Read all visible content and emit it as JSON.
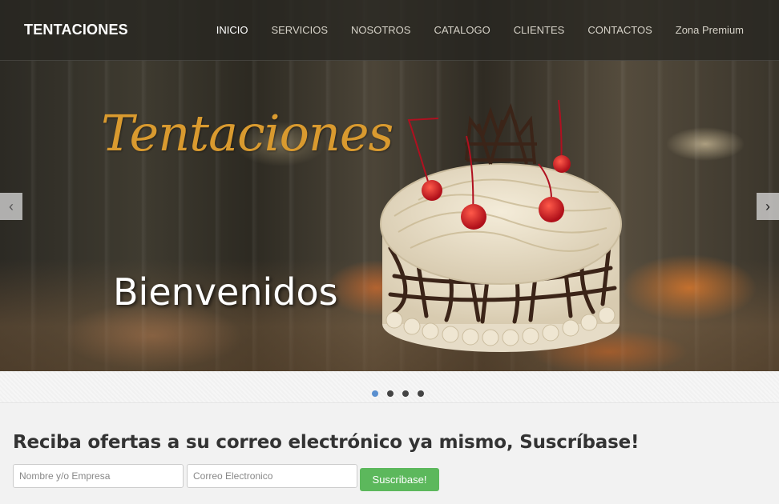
{
  "navbar": {
    "brand": "TENTACIONES",
    "items": [
      {
        "label": "INICIO"
      },
      {
        "label": "SERVICIOS"
      },
      {
        "label": "NOSOTROS"
      },
      {
        "label": "CATALOGO"
      },
      {
        "label": "CLIENTES"
      },
      {
        "label": "CONTACTOS"
      },
      {
        "label": "Zona Premium"
      }
    ],
    "active_index": 0
  },
  "slider": {
    "script_title": "Tentaciones",
    "caption": "Bienvenidos",
    "prev_icon": "chevron-left-icon",
    "next_icon": "chevron-right-icon",
    "prev_glyph": "‹",
    "next_glyph": "›",
    "slide_count": 4,
    "active_slide": 1
  },
  "subscribe": {
    "title": "Reciba ofertas a su correo electrónico ya mismo, Suscríbase!",
    "name_placeholder": "Nombre y/o Empresa",
    "email_placeholder": "Correo Electronico",
    "button_label": "Suscribase!"
  },
  "colors": {
    "accent_gold": "#d99a2f",
    "button_green": "#5cb85c",
    "dot_active": "#5a8fcf"
  }
}
